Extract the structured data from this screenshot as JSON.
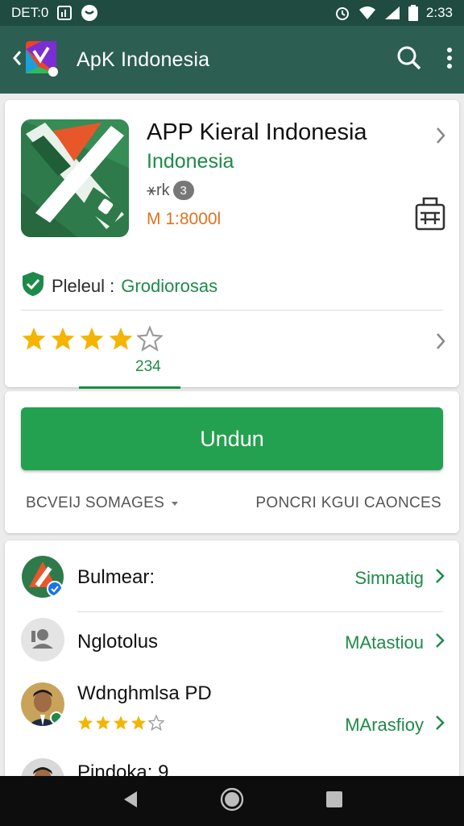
{
  "status_bar": {
    "left_text": "DET:0",
    "time": "2:33",
    "icons": [
      "gallery-icon",
      "chat-icon",
      "alarm-icon",
      "wifi-icon",
      "signal-icon",
      "battery-icon"
    ]
  },
  "app_bar": {
    "title": "ApK Indonesia",
    "icons": [
      "back-icon",
      "search-icon",
      "more-vert-icon"
    ]
  },
  "app_info": {
    "name": "APP Kieral Indonesia",
    "developer": "Indonesia",
    "meta_label": "⚹rk",
    "meta_badge": "3",
    "size": "M 1:8000l",
    "verified_label": "Pleleul :",
    "verified_value": "Grodiorosas",
    "rating_value": 4,
    "rating_max": 5,
    "rating_count": "234"
  },
  "install": {
    "button_label": "Undun",
    "left_link": "BCVEIJ SOMAGES",
    "right_link": "PONCRI KGUI CAONCES"
  },
  "list": [
    {
      "title": "Bulmear:",
      "action": "Simnatig",
      "avatar": "app-logo"
    },
    {
      "title": "Nglotolus",
      "action": "MAtastiou",
      "avatar": "person-placeholder"
    },
    {
      "title": "Wdnghmlsa PD",
      "action": "MArasfioy",
      "avatar": "person-photo",
      "rating": 4
    },
    {
      "title": "Pindoka: 9",
      "action": "",
      "avatar": "person-photo"
    }
  ],
  "colors": {
    "primary_dark": "#1f4b40",
    "primary": "#2c5e52",
    "accent_green": "#24a150",
    "text_green": "#1e8a4a",
    "orange": "#e0731e",
    "star": "#f4b400"
  }
}
